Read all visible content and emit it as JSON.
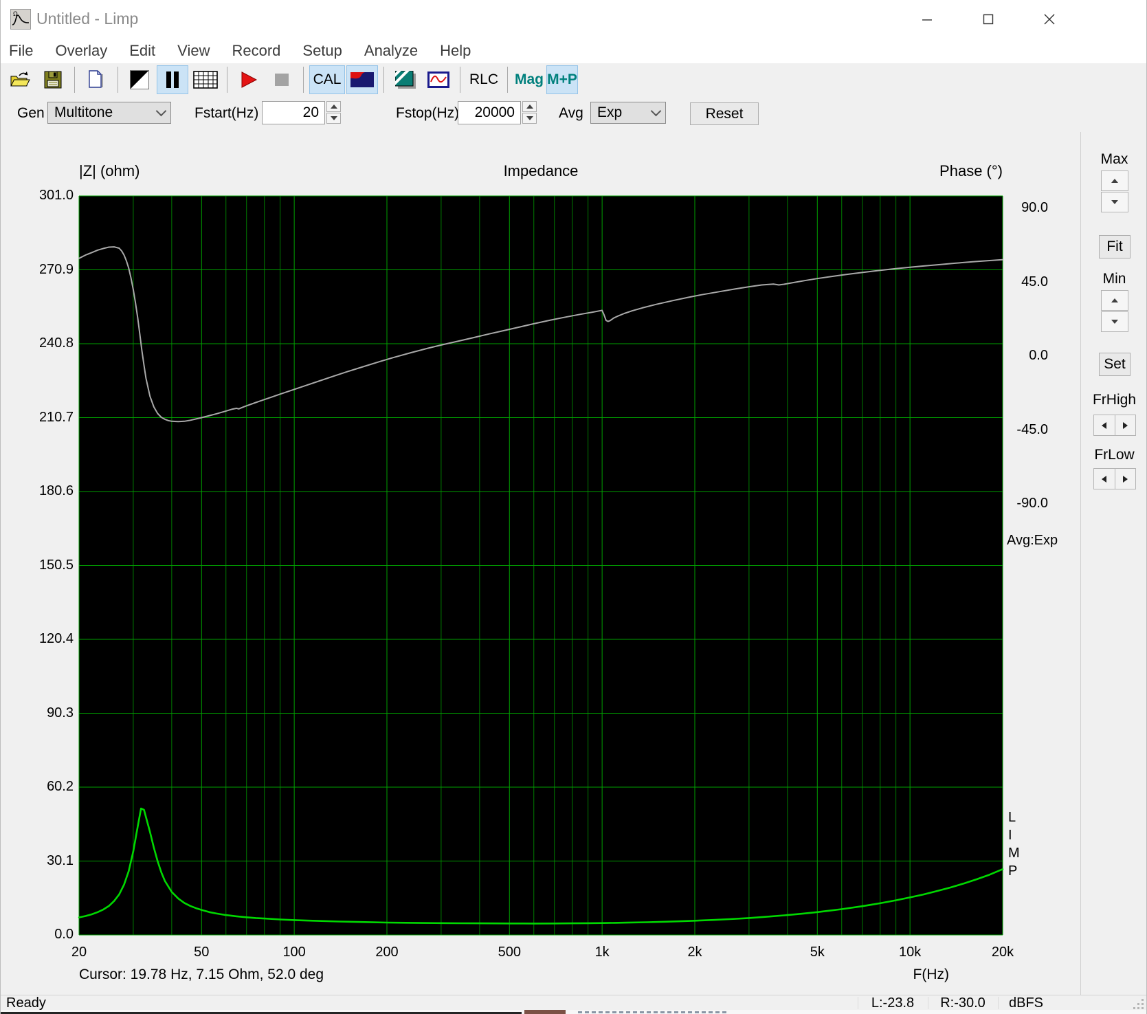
{
  "window": {
    "title": "Untitled - Limp",
    "status": "Ready",
    "status_right": [
      "L:-23.8",
      "R:-30.0",
      "dBFS"
    ]
  },
  "menu": [
    "File",
    "Overlay",
    "Edit",
    "View",
    "Record",
    "Setup",
    "Analyze",
    "Help"
  ],
  "toolbar": {
    "cal": "CAL",
    "rlc": "RLC",
    "mag": "Mag",
    "mp": "M+P"
  },
  "controls": {
    "gen_label": "Gen",
    "gen_value": "Multitone",
    "fstart_label": "Fstart(Hz)",
    "fstart_value": "20",
    "fstop_label": "Fstop(Hz)",
    "fstop_value": "20000",
    "avg_label": "Avg",
    "avg_value": "Exp",
    "reset_label": "Reset"
  },
  "side_panel": {
    "max_label": "Max",
    "fit_label": "Fit",
    "min_label": "Min",
    "set_label": "Set",
    "frhigh_label": "FrHigh",
    "frlow_label": "FrLow"
  },
  "chart_data": {
    "type": "line",
    "title": "Impedance",
    "left_axis_label": "|Z| (ohm)",
    "right_axis_label": "Phase (°)",
    "x_axis_label": "F(Hz)",
    "x_scale": "log",
    "x_range": [
      20,
      20000
    ],
    "x_ticks": [
      "20",
      "50",
      "100",
      "200",
      "500",
      "1k",
      "2k",
      "5k",
      "10k",
      "20k"
    ],
    "x_tick_values": [
      20,
      50,
      100,
      200,
      500,
      1000,
      2000,
      5000,
      10000,
      20000
    ],
    "z_range": [
      0,
      301
    ],
    "z_ticks": [
      "301.0",
      "270.9",
      "240.8",
      "210.7",
      "180.6",
      "150.5",
      "120.4",
      "90.3",
      "60.2",
      "30.1",
      "0.0"
    ],
    "phase_ticks": [
      "90.0",
      "45.0",
      "0.0",
      "-45.0",
      "-90.0"
    ],
    "phase_deg_per_division": 45,
    "grid_divisions": 10,
    "plot_bg": "#000000",
    "grid_color": "#007c00",
    "grid_major_color": "#00a000",
    "annotations": {
      "avg": "Avg:Exp",
      "watermark": "LIMP",
      "cursor": "Cursor: 19.78 Hz, 7.15 Ohm, 52.0 deg"
    },
    "series": [
      {
        "name": "impedance_ohm",
        "axis": "z",
        "color": "#00d800",
        "points": [
          [
            20,
            7.15
          ],
          [
            21,
            7.7
          ],
          [
            22,
            8.4
          ],
          [
            23,
            9.3
          ],
          [
            24,
            10.4
          ],
          [
            25,
            11.8
          ],
          [
            26,
            13.8
          ],
          [
            27,
            16.5
          ],
          [
            28,
            20.5
          ],
          [
            29,
            26
          ],
          [
            30,
            34
          ],
          [
            31,
            44
          ],
          [
            31.8,
            51.5
          ],
          [
            32.5,
            51
          ],
          [
            33,
            48
          ],
          [
            34,
            42
          ],
          [
            35,
            35.5
          ],
          [
            36,
            30
          ],
          [
            37,
            25.5
          ],
          [
            38,
            22
          ],
          [
            40,
            17.5
          ],
          [
            42,
            14.8
          ],
          [
            44,
            13
          ],
          [
            46,
            11.8
          ],
          [
            48,
            10.9
          ],
          [
            50,
            10.2
          ],
          [
            53,
            9.3
          ],
          [
            56,
            8.7
          ],
          [
            60,
            8.1
          ],
          [
            65,
            7.6
          ],
          [
            70,
            7.2
          ],
          [
            75,
            6.9
          ],
          [
            80,
            6.7
          ],
          [
            90,
            6.3
          ],
          [
            100,
            6.05
          ],
          [
            110,
            5.85
          ],
          [
            120,
            5.7
          ],
          [
            140,
            5.45
          ],
          [
            160,
            5.3
          ],
          [
            180,
            5.15
          ],
          [
            200,
            5.05
          ],
          [
            230,
            4.95
          ],
          [
            260,
            4.88
          ],
          [
            300,
            4.82
          ],
          [
            350,
            4.76
          ],
          [
            400,
            4.72
          ],
          [
            450,
            4.7
          ],
          [
            500,
            4.68
          ],
          [
            600,
            4.66
          ],
          [
            700,
            4.68
          ],
          [
            800,
            4.72
          ],
          [
            900,
            4.78
          ],
          [
            1000,
            4.85
          ],
          [
            1100,
            4.92
          ],
          [
            1200,
            5
          ],
          [
            1400,
            5.18
          ],
          [
            1600,
            5.38
          ],
          [
            1800,
            5.58
          ],
          [
            2000,
            5.8
          ],
          [
            2300,
            6.1
          ],
          [
            2600,
            6.45
          ],
          [
            3000,
            6.9
          ],
          [
            3500,
            7.5
          ],
          [
            4000,
            8.1
          ],
          [
            4500,
            8.7
          ],
          [
            5000,
            9.3
          ],
          [
            5500,
            9.9
          ],
          [
            6000,
            10.5
          ],
          [
            7000,
            11.7
          ],
          [
            8000,
            12.9
          ],
          [
            9000,
            14.1
          ],
          [
            10000,
            15.3
          ],
          [
            11000,
            16.4
          ],
          [
            12000,
            17.6
          ],
          [
            13500,
            19.3
          ],
          [
            15000,
            21
          ],
          [
            16500,
            22.7
          ],
          [
            18000,
            24.4
          ],
          [
            20000,
            26.8
          ]
        ]
      },
      {
        "name": "phase_deg",
        "axis": "phase",
        "color": "#a9a9a9",
        "points": [
          [
            20,
            52
          ],
          [
            21,
            54
          ],
          [
            22,
            55.5
          ],
          [
            23,
            57
          ],
          [
            24,
            58
          ],
          [
            25,
            58.8
          ],
          [
            26,
            59
          ],
          [
            27,
            58.2
          ],
          [
            27.5,
            56.5
          ],
          [
            28,
            54
          ],
          [
            28.5,
            50.5
          ],
          [
            29,
            46
          ],
          [
            29.5,
            40
          ],
          [
            30,
            33
          ],
          [
            30.5,
            25
          ],
          [
            31,
            16
          ],
          [
            31.5,
            6
          ],
          [
            32,
            -4
          ],
          [
            32.5,
            -13
          ],
          [
            33,
            -21
          ],
          [
            34,
            -32
          ],
          [
            35,
            -38.5
          ],
          [
            36,
            -42.5
          ],
          [
            37,
            -44.8
          ],
          [
            38,
            -46
          ],
          [
            39,
            -46.8
          ],
          [
            40,
            -47.2
          ],
          [
            42,
            -47.4
          ],
          [
            44,
            -47.2
          ],
          [
            46,
            -46.6
          ],
          [
            48,
            -45.8
          ],
          [
            50,
            -45
          ],
          [
            53,
            -43.8
          ],
          [
            56,
            -42.6
          ],
          [
            60,
            -41
          ],
          [
            63,
            -39.8
          ],
          [
            65,
            -39.3
          ],
          [
            66,
            -39.7
          ],
          [
            68,
            -38.7
          ],
          [
            70,
            -37.8
          ],
          [
            75,
            -35.8
          ],
          [
            80,
            -34
          ],
          [
            85,
            -32.3
          ],
          [
            90,
            -30.7
          ],
          [
            100,
            -27.8
          ],
          [
            110,
            -25.2
          ],
          [
            120,
            -22.8
          ],
          [
            135,
            -19.6
          ],
          [
            150,
            -16.8
          ],
          [
            170,
            -13.6
          ],
          [
            190,
            -10.8
          ],
          [
            210,
            -8.4
          ],
          [
            240,
            -5.4
          ],
          [
            270,
            -2.9
          ],
          [
            300,
            -0.8
          ],
          [
            340,
            1.5
          ],
          [
            380,
            3.6
          ],
          [
            430,
            6
          ],
          [
            480,
            8
          ],
          [
            540,
            10.2
          ],
          [
            600,
            12.2
          ],
          [
            680,
            14.4
          ],
          [
            760,
            16.2
          ],
          [
            850,
            17.9
          ],
          [
            930,
            19.2
          ],
          [
            980,
            20
          ],
          [
            1000,
            20.3
          ],
          [
            1015,
            17.5
          ],
          [
            1030,
            14.2
          ],
          [
            1045,
            13.6
          ],
          [
            1060,
            14
          ],
          [
            1090,
            15.6
          ],
          [
            1130,
            17
          ],
          [
            1180,
            18.4
          ],
          [
            1250,
            20
          ],
          [
            1350,
            21.8
          ],
          [
            1500,
            24
          ],
          [
            1700,
            26.3
          ],
          [
            1900,
            28.2
          ],
          [
            2100,
            29.8
          ],
          [
            2400,
            31.7
          ],
          [
            2700,
            33.3
          ],
          [
            3000,
            34.7
          ],
          [
            3300,
            35.8
          ],
          [
            3600,
            36.3
          ],
          [
            3750,
            35.8
          ],
          [
            3900,
            36.2
          ],
          [
            4200,
            37.3
          ],
          [
            4600,
            38.6
          ],
          [
            5000,
            39.7
          ],
          [
            5500,
            40.8
          ],
          [
            6000,
            41.8
          ],
          [
            6600,
            42.8
          ],
          [
            7300,
            43.8
          ],
          [
            8000,
            44.7
          ],
          [
            9000,
            45.7
          ],
          [
            10000,
            46.6
          ],
          [
            11000,
            47.3
          ],
          [
            12500,
            48.2
          ],
          [
            14000,
            49
          ],
          [
            16000,
            49.9
          ],
          [
            18000,
            50.6
          ],
          [
            20000,
            51.2
          ]
        ]
      }
    ]
  },
  "colors": {
    "selected_button_bg": "#cbe3f6",
    "selected_button_border": "#94c3e8",
    "teal_accent": "#00807d",
    "plot_bg": "#000000"
  }
}
